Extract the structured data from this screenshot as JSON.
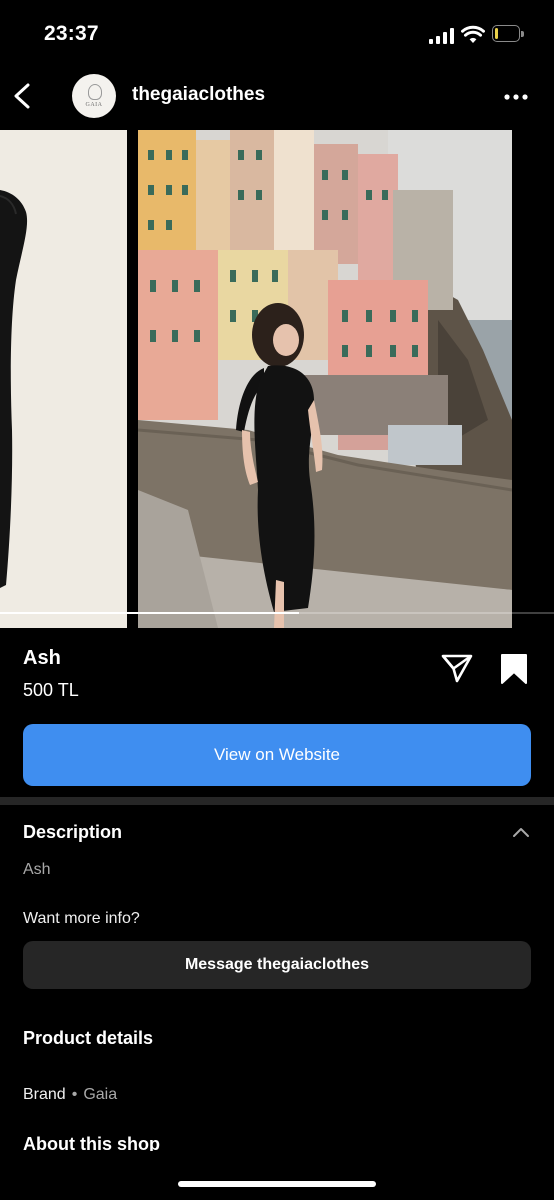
{
  "status_bar": {
    "time": "23:37",
    "battery_level": "1",
    "battery_fraction": 0.12
  },
  "header": {
    "username": "thegaiaclothes",
    "avatar_text": "GAIA"
  },
  "carousel": {
    "current_index": 2,
    "progress_fraction": 0.54
  },
  "product": {
    "name": "Ash",
    "price": "500 TL",
    "cta_label": "View on Website"
  },
  "description": {
    "heading": "Description",
    "text": "Ash",
    "info_prompt": "Want more info?",
    "message_label": "Message thegaiaclothes"
  },
  "details": {
    "heading": "Product details",
    "brand_label": "Brand",
    "separator": "•",
    "brand_value": "Gaia"
  },
  "about": {
    "heading": "About this shop"
  },
  "colors": {
    "accent": "#3f8ef0",
    "background": "#000000",
    "secondary_button": "#262626"
  },
  "icons": {
    "back": "chevron-left-icon",
    "more": "ellipsis-icon",
    "share": "paper-plane-icon",
    "save": "bookmark-icon",
    "collapse": "chevron-up-icon"
  }
}
